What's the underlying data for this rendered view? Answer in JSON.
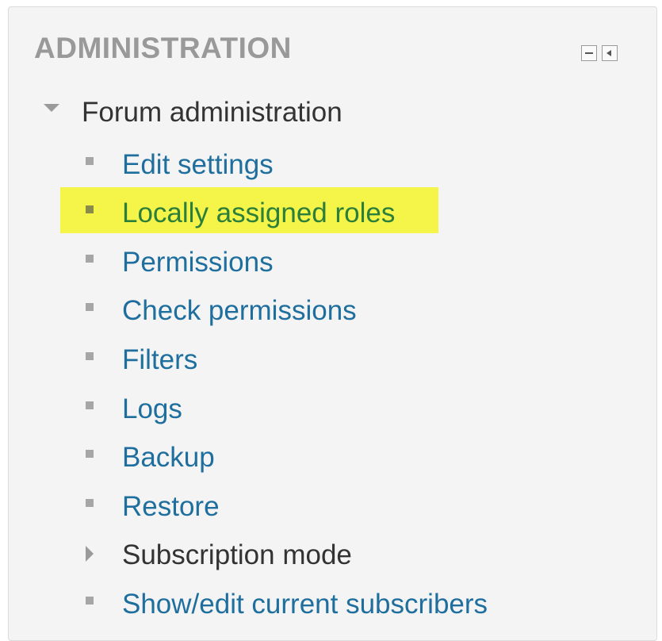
{
  "block": {
    "title": "ADMINISTRATION",
    "actions": [
      {
        "icon": "minimize-icon"
      },
      {
        "icon": "dock-icon"
      }
    ]
  },
  "tree": {
    "root_label": "Forum administration",
    "items": [
      {
        "label": "Edit settings"
      },
      {
        "label": "Locally assigned roles",
        "highlighted": true
      },
      {
        "label": "Permissions"
      },
      {
        "label": "Check permissions"
      },
      {
        "label": "Filters"
      },
      {
        "label": "Logs"
      },
      {
        "label": "Backup"
      },
      {
        "label": "Restore"
      },
      {
        "label": "Subscription mode",
        "collapsible": true
      },
      {
        "label": "Show/edit current subscribers"
      }
    ]
  },
  "colors": {
    "link": "#1e6e9e",
    "highlight": "#f4f449",
    "highlight_text": "#2b7f3a",
    "title": "#999999"
  }
}
